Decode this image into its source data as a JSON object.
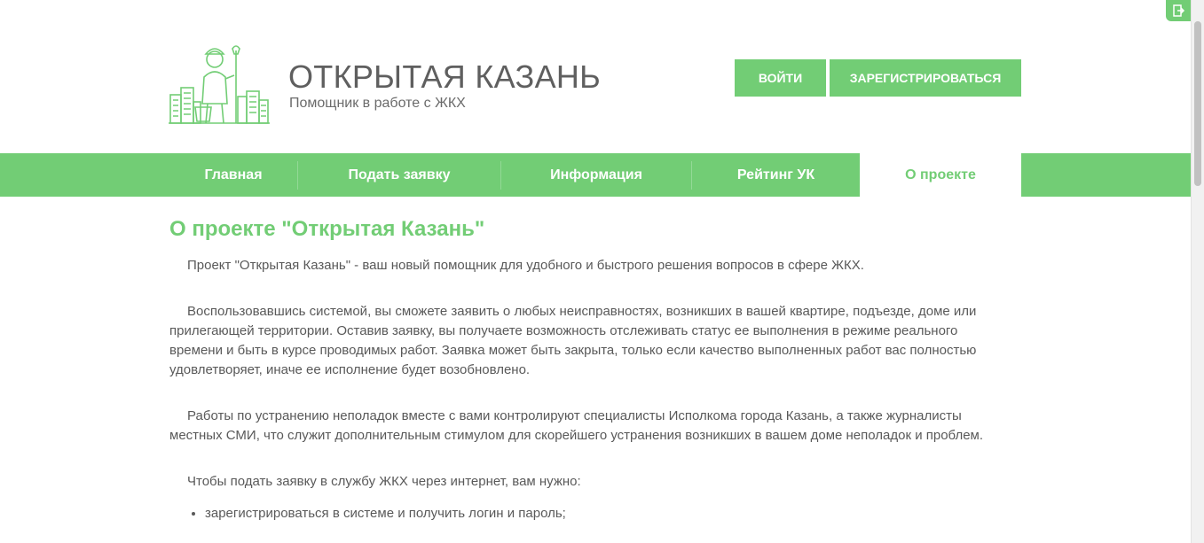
{
  "header": {
    "title": "ОТКРЫТАЯ КАЗАНЬ",
    "subtitle": "Помощник в работе с ЖКХ",
    "login_label": "ВОЙТИ",
    "register_label": "ЗАРЕГИСТРИРОВАТЬСЯ"
  },
  "nav": {
    "items": [
      {
        "label": "Главная"
      },
      {
        "label": "Подать заявку"
      },
      {
        "label": "Информация"
      },
      {
        "label": "Рейтинг УК"
      },
      {
        "label": "О проекте"
      }
    ],
    "active": "О проекте"
  },
  "content": {
    "heading": "О проекте \"Открытая Казань\"",
    "paragraphs": [
      "Проект \"Открытая Казань\" - ваш новый помощник для удобного и быстрого решения вопросов в сфере ЖКХ.",
      "Воспользовавшись системой, вы сможете заявить о любых неисправностях, возникших в вашей квартире, подъезде, доме или прилегающей территории. Оставив заявку, вы получаете возможность отслеживать статус ее выполнения в режиме реального времени и быть в курсе проводимых работ. Заявка может быть закрыта, только если качество выполненных работ вас полностью удовлетворяет, иначе ее исполнение будет возобновлено.",
      "Работы по устранению неполадок вместе с вами контролируют специалисты Исполкома города Казань, а также журналисты местных СМИ, что служит дополнительным стимулом для скорейшего устранения возникших в вашем доме неполадок и проблем.",
      "Чтобы подать заявку в службу ЖКХ через интернет, вам нужно:"
    ],
    "list": [
      "зарегистрироваться в системе и получить логин и пароль;"
    ]
  },
  "colors": {
    "accent": "#72cd75",
    "text": "#595959",
    "title": "#5f5f5f"
  },
  "icons": {
    "logo": "worker-city-logo-icon",
    "corner": "exit-door-icon"
  }
}
